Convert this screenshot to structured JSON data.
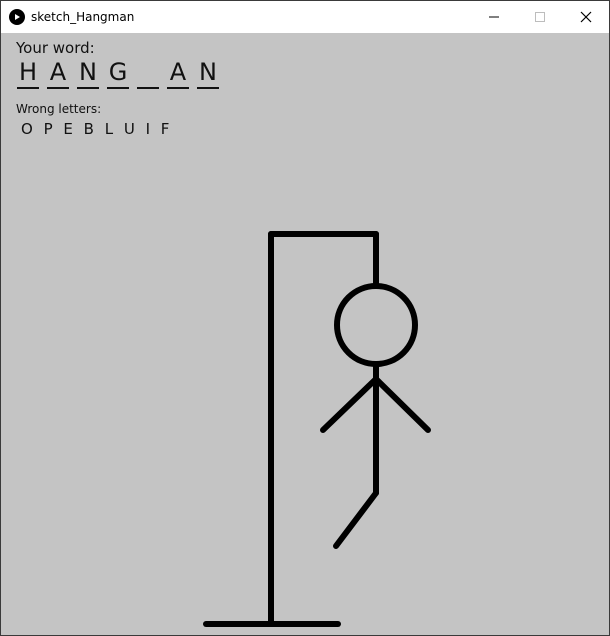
{
  "window": {
    "title": "sketch_Hangman",
    "controls": [
      "minimize",
      "maximize",
      "close"
    ]
  },
  "game": {
    "your_word_label": "Your word:",
    "word_slots": [
      "H",
      "A",
      "N",
      "G",
      "",
      "A",
      "N"
    ],
    "wrong_letters_label": "Wrong letters:",
    "wrong_letters": "O P E B L U I F"
  },
  "drawing": {
    "stroke_color": "#000000",
    "background_color": "#c4c4c4",
    "parts_shown": [
      "base",
      "pole",
      "beam",
      "rope",
      "head",
      "body",
      "left-arm",
      "right-arm",
      "left-leg"
    ]
  },
  "icons": {
    "app": "play-icon",
    "minimize": "minimize-icon",
    "maximize": "maximize-icon",
    "close": "close-icon"
  }
}
